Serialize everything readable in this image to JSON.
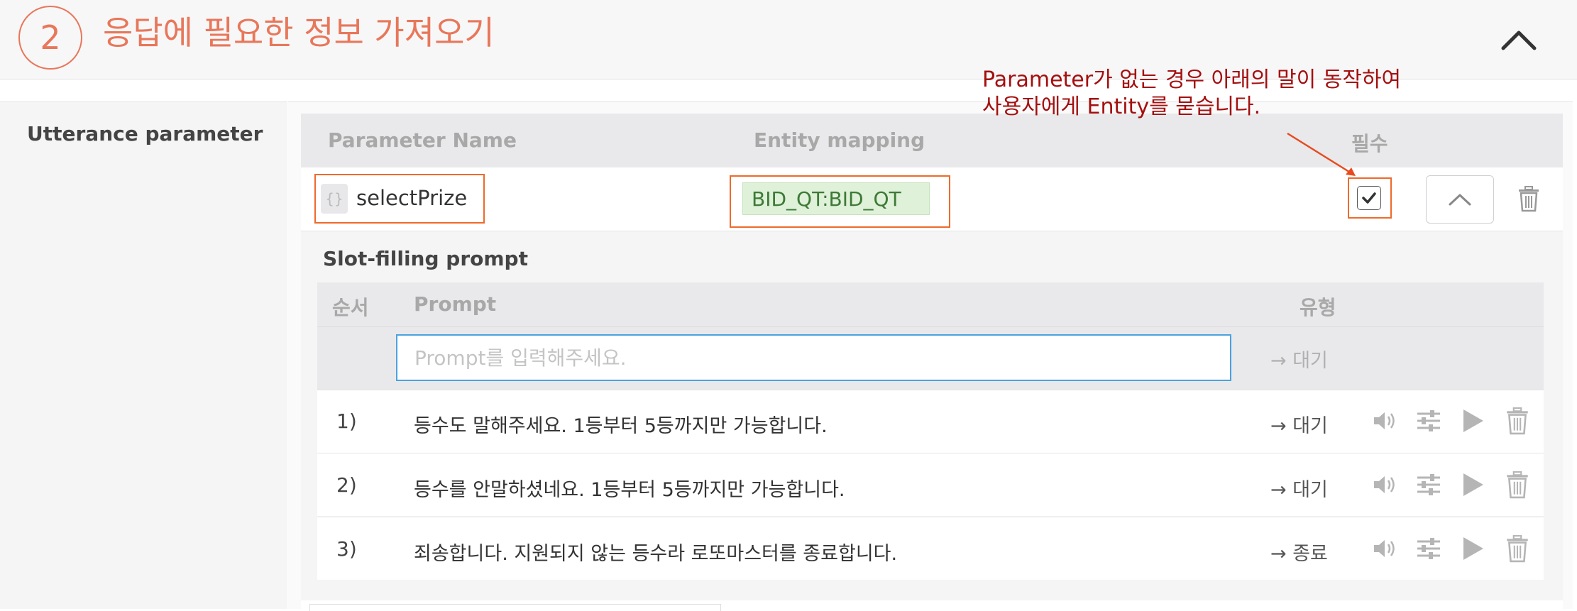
{
  "header": {
    "step_number": "2",
    "title": "응답에 필요한 정보 가져오기"
  },
  "annotation": {
    "line1": "Parameter가 없는 경우 아래의 말이 동작하여",
    "line2": "사용자에게 Entity를 묻습니다."
  },
  "section": {
    "label": "Utterance parameter"
  },
  "param_table": {
    "columns": {
      "name": "Parameter Name",
      "entity": "Entity mapping",
      "required": "필수"
    },
    "row": {
      "brace_icon": "{}",
      "name": "selectPrize",
      "entity": "BID_QT:BID_QT",
      "required": true
    }
  },
  "slot_filling": {
    "title": "Slot-filling prompt",
    "columns": {
      "order": "순서",
      "prompt": "Prompt",
      "type": "유형"
    },
    "input": {
      "placeholder": "Prompt를 입력해주세요.",
      "type_label": "→ 대기"
    },
    "prompts": [
      {
        "idx": "1)",
        "text": "등수도 말해주세요. 1등부터 5등까지만 가능합니다.",
        "type": "→ 대기"
      },
      {
        "idx": "2)",
        "text": "등수를 안말하셨네요. 1등부터 5등까지만 가능합니다.",
        "type": "→ 대기"
      },
      {
        "idx": "3)",
        "text": "죄송합니다. 지원되지 않는 등수라 로또마스터를 종료합니다.",
        "type": "→ 종료"
      }
    ]
  },
  "colors": {
    "accent_orange": "#e8775a",
    "highlight_border": "#ee6a2a",
    "annotation_red": "#a40f0f",
    "entity_green": "#3d7a36",
    "input_focus_blue": "#4aa3df"
  },
  "icons": {
    "collapse": "chevron-up-icon",
    "trash": "trash-icon",
    "speaker": "speaker-icon",
    "settings": "sliders-icon",
    "play": "play-icon",
    "checkbox": "checkmark-icon"
  }
}
